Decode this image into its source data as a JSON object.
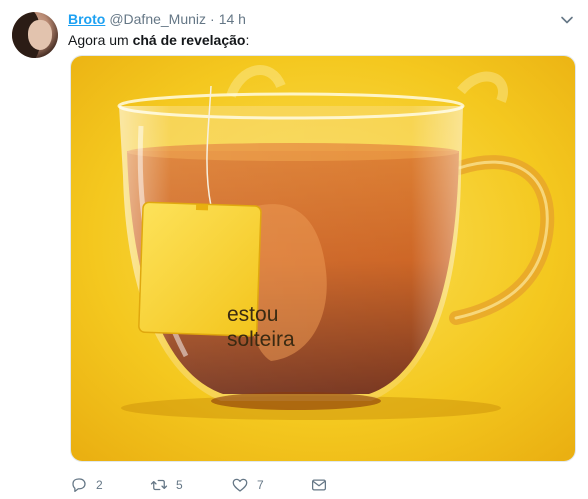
{
  "tweet": {
    "display_name": "Broto",
    "handle": "@Dafne_Muniz",
    "separator": "·",
    "time": "14 h",
    "text_prefix": "Agora um ",
    "text_bold": "chá de revelação",
    "text_suffix": ":"
  },
  "media": {
    "tag_line1": "estou",
    "tag_line2": "solteira"
  },
  "actions": {
    "replies": "2",
    "retweets": "5",
    "likes": "7"
  },
  "colors": {
    "accent": "#1da1f2",
    "muted": "#657786",
    "background_yellow": "#f2c21a"
  },
  "icons": {
    "caret": "chevron-down-icon",
    "reply": "reply-icon",
    "retweet": "retweet-icon",
    "like": "heart-icon",
    "dm": "envelope-icon"
  }
}
